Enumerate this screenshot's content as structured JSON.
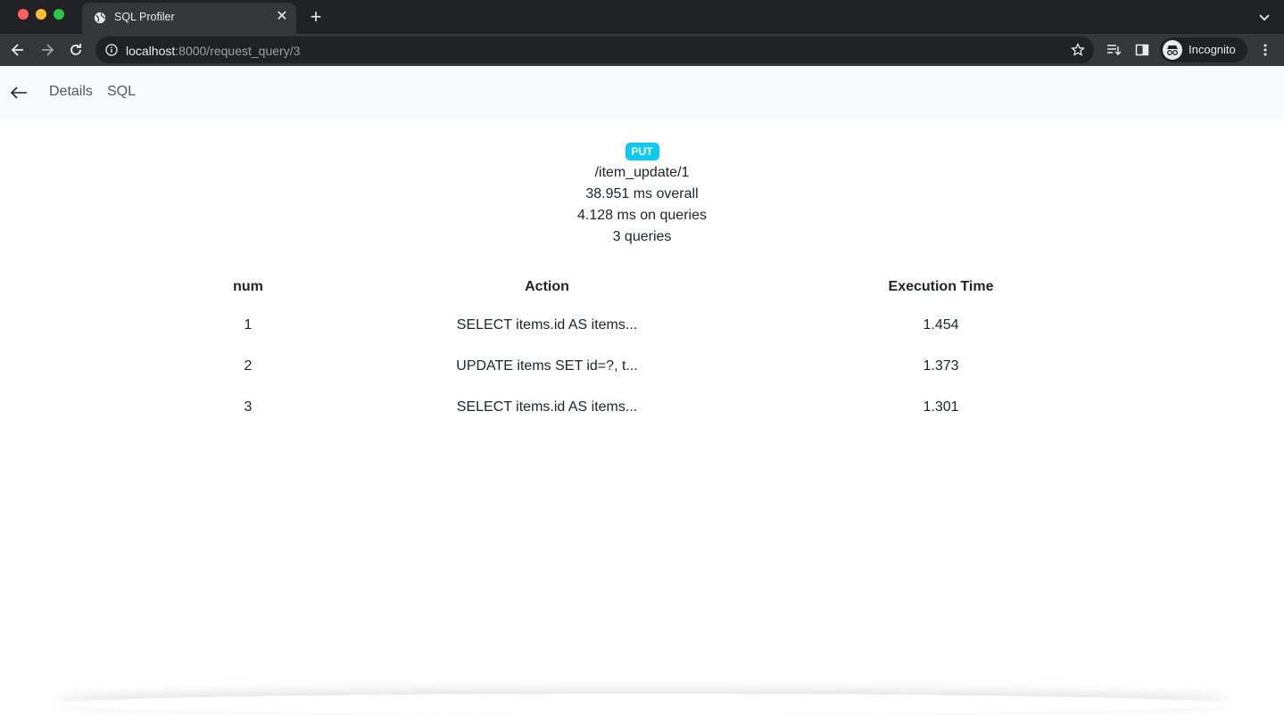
{
  "browser": {
    "tab_title": "SQL Profiler",
    "url_host": "localhost",
    "url_path": ":8000/request_query/3",
    "profile_label": "Incognito"
  },
  "nav": {
    "back_icon": "arrow-left-icon",
    "links": [
      "Details",
      "SQL"
    ]
  },
  "request": {
    "method": "PUT",
    "path": "/item_update/1",
    "overall": "38.951 ms overall",
    "on_queries": "4.128 ms on queries",
    "query_count": "3 queries"
  },
  "table": {
    "headers": [
      "num",
      "Action",
      "Execution Time"
    ],
    "rows": [
      {
        "num": "1",
        "action": "SELECT items.id AS items...",
        "time": "1.454"
      },
      {
        "num": "2",
        "action": "UPDATE items SET id=?, t...",
        "time": "1.373"
      },
      {
        "num": "3",
        "action": "SELECT items.id AS items...",
        "time": "1.301"
      }
    ]
  },
  "colors": {
    "badge": "#0dcaf0",
    "nav_bg": "#f8f9fa",
    "chrome_dark": "#202124",
    "chrome_tab": "#35363a"
  }
}
